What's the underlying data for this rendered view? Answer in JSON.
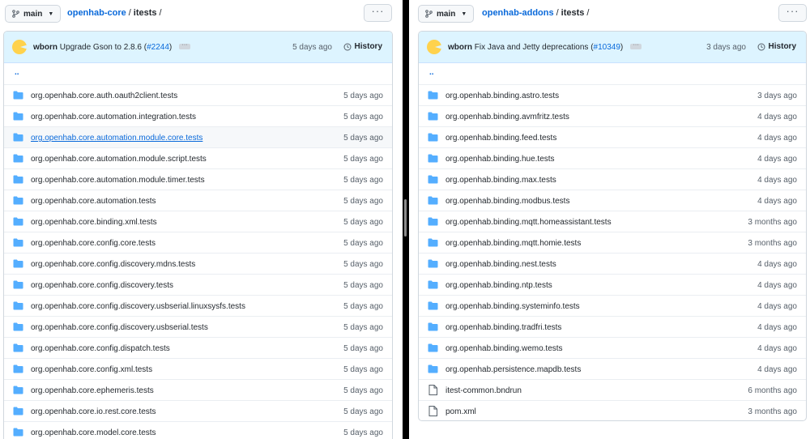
{
  "left": {
    "branch": "main",
    "repo": "openhab-core",
    "dir": "itests",
    "sep": "/",
    "more": "···",
    "commit": {
      "author": "wborn",
      "message": "Upgrade Gson to 2.8.6 (",
      "link": "#2244",
      "close": ")",
      "ellipsis": "···",
      "age": "5 days ago",
      "history": "History"
    },
    "up": "..",
    "rows": [
      {
        "name": "org.openhab.core.auth.oauth2client.tests",
        "age": "5 days ago",
        "type": "folder"
      },
      {
        "name": "org.openhab.core.automation.integration.tests",
        "age": "5 days ago",
        "type": "folder"
      },
      {
        "name": "org.openhab.core.automation.module.core.tests",
        "age": "5 days ago",
        "type": "folder",
        "hover": true
      },
      {
        "name": "org.openhab.core.automation.module.script.tests",
        "age": "5 days ago",
        "type": "folder"
      },
      {
        "name": "org.openhab.core.automation.module.timer.tests",
        "age": "5 days ago",
        "type": "folder"
      },
      {
        "name": "org.openhab.core.automation.tests",
        "age": "5 days ago",
        "type": "folder"
      },
      {
        "name": "org.openhab.core.binding.xml.tests",
        "age": "5 days ago",
        "type": "folder"
      },
      {
        "name": "org.openhab.core.config.core.tests",
        "age": "5 days ago",
        "type": "folder"
      },
      {
        "name": "org.openhab.core.config.discovery.mdns.tests",
        "age": "5 days ago",
        "type": "folder"
      },
      {
        "name": "org.openhab.core.config.discovery.tests",
        "age": "5 days ago",
        "type": "folder"
      },
      {
        "name": "org.openhab.core.config.discovery.usbserial.linuxsysfs.tests",
        "age": "5 days ago",
        "type": "folder"
      },
      {
        "name": "org.openhab.core.config.discovery.usbserial.tests",
        "age": "5 days ago",
        "type": "folder"
      },
      {
        "name": "org.openhab.core.config.dispatch.tests",
        "age": "5 days ago",
        "type": "folder"
      },
      {
        "name": "org.openhab.core.config.xml.tests",
        "age": "5 days ago",
        "type": "folder"
      },
      {
        "name": "org.openhab.core.ephemeris.tests",
        "age": "5 days ago",
        "type": "folder"
      },
      {
        "name": "org.openhab.core.io.rest.core.tests",
        "age": "5 days ago",
        "type": "folder"
      },
      {
        "name": "org.openhab.core.model.core.tests",
        "age": "5 days ago",
        "type": "folder"
      }
    ]
  },
  "right": {
    "branch": "main",
    "repo": "openhab-addons",
    "dir": "itests",
    "sep": "/",
    "more": "···",
    "commit": {
      "author": "wborn",
      "message": "Fix Java and Jetty deprecations (",
      "link": "#10349",
      "close": ")",
      "ellipsis": "···",
      "age": "3 days ago",
      "history": "History"
    },
    "up": "..",
    "rows": [
      {
        "name": "org.openhab.binding.astro.tests",
        "age": "3 days ago",
        "type": "folder"
      },
      {
        "name": "org.openhab.binding.avmfritz.tests",
        "age": "4 days ago",
        "type": "folder"
      },
      {
        "name": "org.openhab.binding.feed.tests",
        "age": "4 days ago",
        "type": "folder"
      },
      {
        "name": "org.openhab.binding.hue.tests",
        "age": "4 days ago",
        "type": "folder"
      },
      {
        "name": "org.openhab.binding.max.tests",
        "age": "4 days ago",
        "type": "folder"
      },
      {
        "name": "org.openhab.binding.modbus.tests",
        "age": "4 days ago",
        "type": "folder"
      },
      {
        "name": "org.openhab.binding.mqtt.homeassistant.tests",
        "age": "3 months ago",
        "type": "folder"
      },
      {
        "name": "org.openhab.binding.mqtt.homie.tests",
        "age": "3 months ago",
        "type": "folder"
      },
      {
        "name": "org.openhab.binding.nest.tests",
        "age": "4 days ago",
        "type": "folder"
      },
      {
        "name": "org.openhab.binding.ntp.tests",
        "age": "4 days ago",
        "type": "folder"
      },
      {
        "name": "org.openhab.binding.systeminfo.tests",
        "age": "4 days ago",
        "type": "folder"
      },
      {
        "name": "org.openhab.binding.tradfri.tests",
        "age": "4 days ago",
        "type": "folder"
      },
      {
        "name": "org.openhab.binding.wemo.tests",
        "age": "4 days ago",
        "type": "folder"
      },
      {
        "name": "org.openhab.persistence.mapdb.tests",
        "age": "4 days ago",
        "type": "folder"
      },
      {
        "name": "itest-common.bndrun",
        "age": "6 months ago",
        "type": "file"
      },
      {
        "name": "pom.xml",
        "age": "3 months ago",
        "type": "file"
      }
    ]
  },
  "colors": {
    "link": "#0969da",
    "folder": "#54aeff",
    "commit_bg": "#ddf4ff"
  }
}
